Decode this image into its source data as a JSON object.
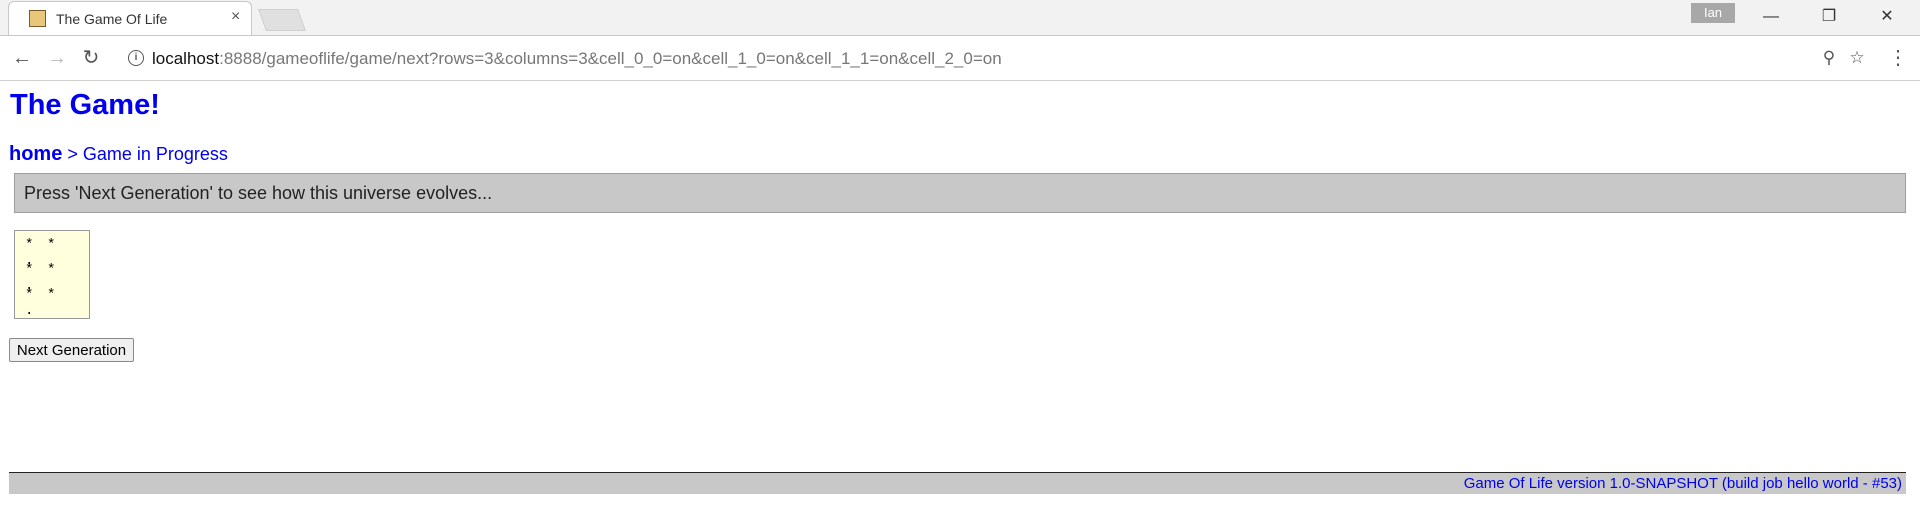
{
  "browser": {
    "tab_title": "The Game Of Life",
    "tab_close": "×",
    "user_name": "Ian",
    "url_host": "localhost",
    "url_rest": ":8888/gameoflife/game/next?rows=3&columns=3&cell_0_0=on&cell_1_0=on&cell_1_1=on&cell_2_0=on",
    "icons": {
      "back": "←",
      "forward": "→",
      "reload": "↻",
      "info": "i",
      "zoom": "⚲",
      "star": "☆",
      "menu": "⋮",
      "minimize": "—",
      "restore": "❐",
      "close": "✕"
    }
  },
  "page": {
    "heading": "The Game!",
    "breadcrumb": {
      "home": "home",
      "separator": " > ",
      "current": "Game in Progress"
    },
    "notice": "Press 'Next Generation' to see how this universe evolves...",
    "grid": {
      "rows": [
        [
          "*",
          "*",
          "."
        ],
        [
          "*",
          "*",
          "."
        ],
        [
          "*",
          "*",
          "."
        ]
      ]
    },
    "next_button": "Next Generation",
    "footer": "Game Of Life version 1.0-SNAPSHOT (build job hello world - #53)"
  }
}
